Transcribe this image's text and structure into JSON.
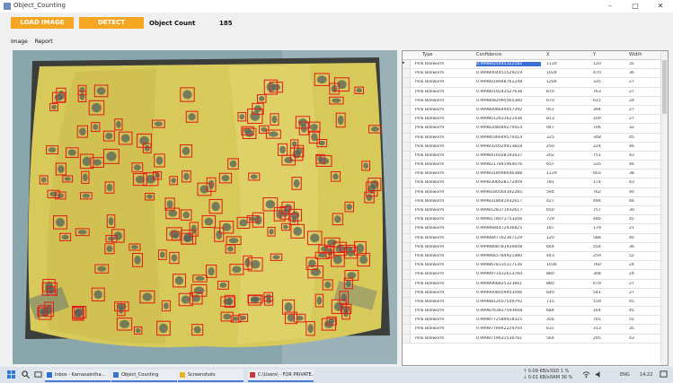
{
  "window": {
    "title": "Object_Counting",
    "controls": [
      "–",
      "□",
      "✕"
    ]
  },
  "toolbar": {
    "load_label": "LOAD IMAGE",
    "detect_label": "DETECT",
    "count_label": "Object Count",
    "count_value": "185",
    "accent": "#f5a623"
  },
  "tabs": [
    "Image",
    "Report"
  ],
  "image": {
    "box_color": "#e11b1b",
    "icon": "detection-image"
  },
  "grid": {
    "columns": [
      "Type",
      "Confidence",
      "X",
      "Y",
      "Width"
    ],
    "rows": [
      [
        "Pink Bollworm",
        "0.9998425445322182",
        "1120",
        "120",
        "35"
      ],
      [
        "Pink Bollworm",
        "0.9998004451529219",
        "1024",
        "470",
        "36"
      ],
      [
        "Pink Bollworm",
        "0.9998018948761248",
        "1200",
        "335",
        "27"
      ],
      [
        "Pink Bollworm",
        "0.9998019243527638",
        "870",
        "763",
        "27"
      ],
      [
        "Pink Bollworm",
        "0.9998082995565360",
        "670",
        "615",
        "24"
      ],
      [
        "Pink Bollworm",
        "0.9998008649457392",
        "951",
        "394",
        "27"
      ],
      [
        "Pink Bollworm",
        "0.9998012631621436",
        "813",
        "109",
        "27"
      ],
      [
        "Pink Bollworm",
        "0.9998208049274414",
        "947",
        "706",
        "32"
      ],
      [
        "Pink Bollworm",
        "0.9998036649574414",
        "325",
        "348",
        "45"
      ],
      [
        "Pink Bollworm",
        "0.9998320029413818",
        "250",
        "224",
        "46"
      ],
      [
        "Pink Bollworm",
        "0.9998416028193437",
        "202",
        "751",
        "43"
      ],
      [
        "Pink Bollworm",
        "0.9998217845964076",
        "657",
        "335",
        "46"
      ],
      [
        "Pink Bollworm",
        "0.9998318096646388",
        "1129",
        "603",
        "38"
      ],
      [
        "Pink Bollworm",
        "0.9998306628172009",
        "781",
        "174",
        "43"
      ],
      [
        "Pink Bollworm",
        "0.9998180564302285",
        "594",
        "762",
        "40"
      ],
      [
        "Pink Bollworm",
        "0.9998318641932617",
        "427",
        "494",
        "46"
      ],
      [
        "Pink Bollworm",
        "0.9998128371932617",
        "650",
        "757",
        "30"
      ],
      [
        "Pink Bollworm",
        "0.9998178071753206",
        "729",
        "446",
        "45"
      ],
      [
        "Pink Bollworm",
        "0.9998684472936825",
        "187",
        "179",
        "21"
      ],
      [
        "Pink Bollworm",
        "0.9998847762367129",
        "120",
        "588",
        "40"
      ],
      [
        "Pink Bollworm",
        "0.9998808781934608",
        "664",
        "554",
        "36"
      ],
      [
        "Pink Bollworm",
        "0.9998665784921480",
        "443",
        "259",
        "52"
      ],
      [
        "Pink Bollworm",
        "0.9998678135317136",
        "1036",
        "760",
        "24"
      ],
      [
        "Pink Bollworm",
        "0.9998971422613760",
        "880",
        "308",
        "24"
      ],
      [
        "Pink Bollworm",
        "0.9998968825323661",
        "880",
        "679",
        "27"
      ],
      [
        "Pink Bollworm",
        "0.9999008059953596",
        "640",
        "541",
        "27"
      ],
      [
        "Pink Bollworm",
        "0.9998812657549792",
        "715",
        "159",
        "45"
      ],
      [
        "Pink Bollworm",
        "0.9998763817593668",
        "684",
        "164",
        "45"
      ],
      [
        "Pink Bollworm",
        "0.9998772589418325",
        "356",
        "765",
        "55"
      ],
      [
        "Pink Bollworm",
        "0.9998778942224704",
        "631",
        "313",
        "35"
      ],
      [
        "Pink Bollworm",
        "0.9998719631530761",
        "564",
        "295",
        "43"
      ]
    ]
  },
  "taskbar": {
    "apps": [
      {
        "label": "Inbox - Karnasaintha...",
        "color": "#2f6fd0"
      },
      {
        "label": "Object_Counting",
        "color": "#3b74c9"
      },
      {
        "label": "Screenshots",
        "color": "#e6b422"
      },
      {
        "label": "C:\\Users\\ - FOR PRIVATE...",
        "color": "#c43a3a"
      }
    ],
    "net1": "↑ 0.09 KB/s",
    "net2": "↓ 0.01 KB/s",
    "stat1": "SSD 1 %",
    "stat2": "RAM 36 %",
    "lang": "ENG",
    "time": "14:22"
  }
}
